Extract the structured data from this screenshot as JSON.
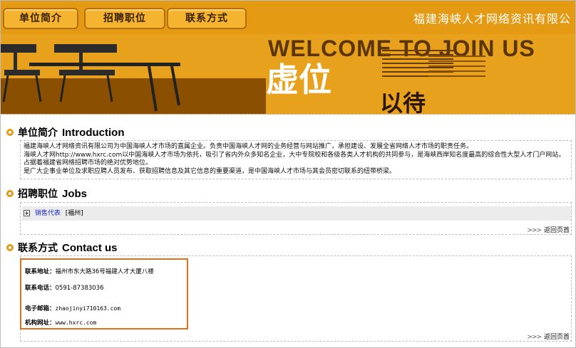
{
  "nav": {
    "items": [
      {
        "label": "单位简介"
      },
      {
        "label": "招聘职位"
      },
      {
        "label": "联系方式"
      }
    ],
    "company_name": "福建海峡人才网络资讯有限公"
  },
  "banner": {
    "welcome": "WELCOME TO JOIN US",
    "line1": "虚位",
    "line2": "以待"
  },
  "intro": {
    "title_cn": "单位简介",
    "title_en": "Introduction",
    "lines": [
      "福建海峡人才网络资讯有限公司为中国海峡人才市场的直属企业。负责中国海峡人才网的业务经营与网站推广，承担建设、发展全省网络人才市场的职责任务。",
      "海峡人才网http://www.hxrc.com以中国海峡人才市场为依托，吸引了省内外众多知名企业，大中专院校和各级各类人才机构的共同参与，是海峡西岸知名度最高的综合性大型人才门户网站，占据着福建省网络招聘市场的绝对优势地位。",
      "是广大企事业单位及求职应聘人员发布、获取招聘信息及其它信息的重要渠道，是中国海峡人才市场与其会员密切联系的纽带桥梁。"
    ]
  },
  "jobs": {
    "title_cn": "招聘职位",
    "title_en": "Jobs",
    "items": [
      {
        "title": "销售代表",
        "location": "[福州]"
      }
    ],
    "back_label": "返回页首"
  },
  "contact": {
    "title_cn": "联系方式",
    "title_en": "Contact us",
    "address_label": "联系地址：",
    "address": "福州市东大路36号福建人才大厦八楼",
    "phone_label": "联系电话：",
    "phone": "0591-87383036",
    "email_label": "电子邮箱：",
    "email": "zhaojinyi710163.com",
    "website_label": "机构网址：",
    "website": "www.hxrc.com",
    "back_label": "返回页首"
  }
}
